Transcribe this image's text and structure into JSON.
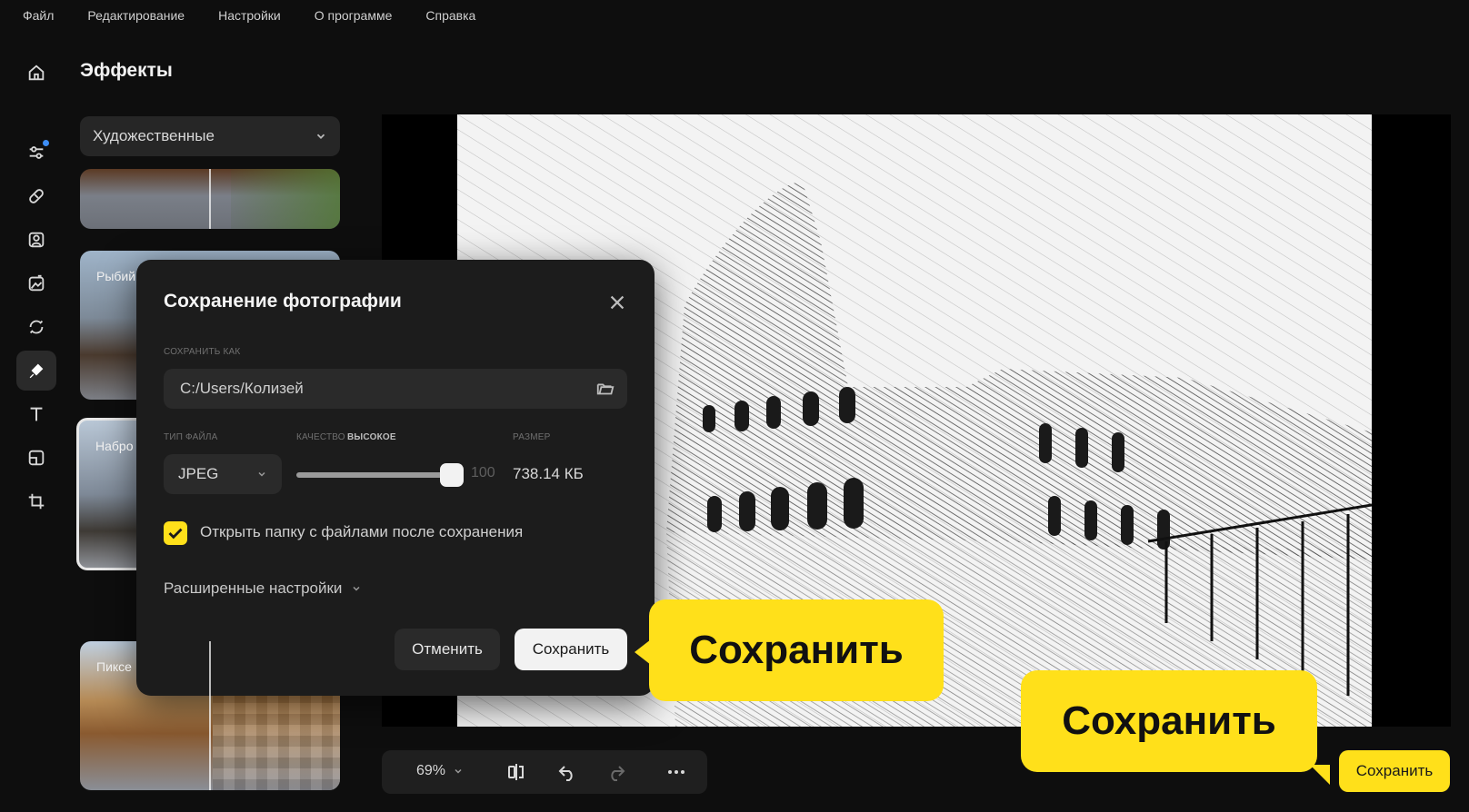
{
  "menu": [
    "Файл",
    "Редактирование",
    "Настройки",
    "О программе",
    "Справка"
  ],
  "panel": {
    "title": "Эффекты",
    "category": "Художественные",
    "thumbs": [
      "Рыбий",
      "Набро",
      "Пиксе"
    ]
  },
  "toolbar": {
    "zoom": "69%"
  },
  "save_main_label": "Сохранить",
  "dialog": {
    "title": "Сохранение фотографии",
    "save_as_label": "СОХРАНИТЬ КАК",
    "path": "C:/Users/Колизей",
    "file_type_label": "ТИП ФАЙЛА",
    "file_type": "JPEG",
    "quality_label": "КАЧЕСТВО",
    "quality_value_label": "ВЫСОКОЕ",
    "quality": 100,
    "quality_display": "100",
    "size_label": "РАЗМЕР",
    "size": "738.14 КБ",
    "open_folder_label": "Открыть папку с файлами после сохранения",
    "open_folder_checked": true,
    "advanced_label": "Расширенные настройки",
    "cancel_label": "Отменить",
    "save_label": "Сохранить"
  },
  "callouts": [
    "Сохранить",
    "Сохранить"
  ],
  "colors": {
    "accent": "#ffe01a",
    "dialog_bg": "#1c1c1c",
    "app_bg": "#0e0e0e"
  }
}
